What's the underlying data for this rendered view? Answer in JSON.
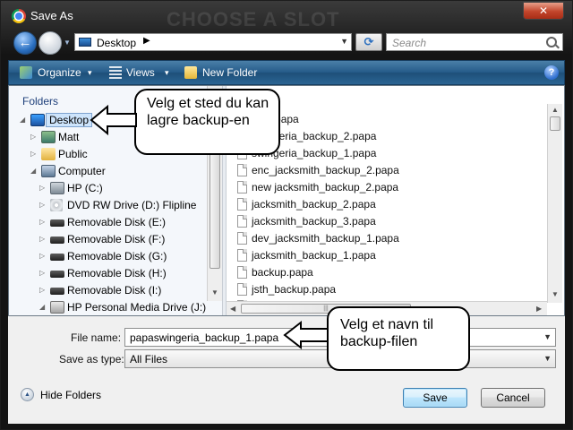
{
  "window": {
    "title": "Save As",
    "close_glyph": "✕",
    "background_banner": "CHOOSE A SLOT"
  },
  "address_bar": {
    "location": "Desktop",
    "crumb_arrow": "▶",
    "dropdown_arrow": "▼"
  },
  "search": {
    "placeholder": "Search"
  },
  "toolbar": {
    "organize_label": "Organize",
    "views_label": "Views",
    "new_folder_label": "New Folder",
    "dropdown_glyph": "▾",
    "help_glyph": "?"
  },
  "nav_pane": {
    "header": "Folders",
    "items": [
      {
        "label": "Desktop",
        "icon": "desktop-icon",
        "expander": "◢",
        "selected": true
      },
      {
        "label": "Matt",
        "icon": "user-folder-icon",
        "expander": "▷"
      },
      {
        "label": "Public",
        "icon": "folder-icon",
        "expander": "▷"
      },
      {
        "label": "Computer",
        "icon": "computer-icon",
        "expander": "◢"
      },
      {
        "label": "HP (C:)",
        "icon": "hard-drive-icon",
        "expander": "▷"
      },
      {
        "label": "DVD RW Drive (D:) Flipline",
        "icon": "dvd-drive-icon",
        "expander": "▷"
      },
      {
        "label": "Removable Disk (E:)",
        "icon": "removable-disk-icon",
        "expander": "▷"
      },
      {
        "label": "Removable Disk (F:)",
        "icon": "removable-disk-icon",
        "expander": "▷"
      },
      {
        "label": "Removable Disk (G:)",
        "icon": "removable-disk-icon",
        "expander": "▷"
      },
      {
        "label": "Removable Disk (H:)",
        "icon": "removable-disk-icon",
        "expander": "▷"
      },
      {
        "label": "Removable Disk (I:)",
        "icon": "removable-disk-icon",
        "expander": "▷"
      },
      {
        "label": "HP Personal Media Drive (J:)",
        "icon": "media-drive-icon",
        "expander": "◢"
      }
    ]
  },
  "file_list": {
    "files": [
      "hing.papa",
      "swingeria_backup_2.papa",
      "swingeria_backup_1.papa",
      "enc_jacksmith_backup_2.papa",
      "new jacksmith_backup_2.papa",
      "jacksmith_backup_2.papa",
      "jacksmith_backup_3.papa",
      "dev_jacksmith_backup_1.papa",
      "jacksmith_backup_1.papa",
      "backup.papa",
      "jsth_backup.papa",
      ""
    ]
  },
  "scrollbars": {
    "up": "▲",
    "down": "▼",
    "left": "◀",
    "right": "▶",
    "grip": "|||"
  },
  "form": {
    "file_name_label": "File name:",
    "file_name_value": "papaswingeria_backup_1.papa",
    "save_type_label": "Save as type:",
    "save_type_value": "All Files",
    "dropdown_glyph": "▼"
  },
  "footer": {
    "hide_folders_label": "Hide Folders",
    "hide_folders_glyph": "▲",
    "save_label": "Save",
    "cancel_label": "Cancel"
  },
  "callouts": {
    "location_tip": "Velg et sted du kan lagre backup-en",
    "filename_tip": "Velg et navn til backup-filen"
  }
}
